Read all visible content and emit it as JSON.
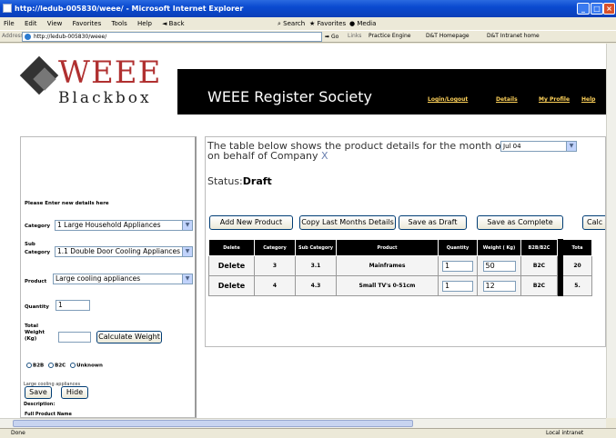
{
  "window": {
    "title": "http://ledub-005830/weee/ - Microsoft Internet Explorer"
  },
  "menu": {
    "items": [
      "File",
      "Edit",
      "View",
      "Favorites",
      "Tools",
      "Help"
    ],
    "back": "Back",
    "search": "Search",
    "favorites": "Favorites",
    "media": "Media"
  },
  "address": {
    "label": "Address",
    "url": "http://ledub-005830/weee/",
    "go": "Go",
    "links_label": "Links",
    "links": [
      "Practice Engine",
      "D&T Homepage",
      "D&T Intranet home"
    ]
  },
  "header": {
    "logo_top": "WEEE",
    "logo_bottom": "Blackbox",
    "society": "WEEE Register Society",
    "nav": [
      "Login/Logout",
      "Details",
      "My Profile",
      "Help"
    ]
  },
  "form": {
    "intro": "Please Enter new details here",
    "category_label": "Category",
    "category_value": "1 Large Household Appliances",
    "sub_label_1": "Sub",
    "sub_label_2": "Category",
    "subcategory_value": "1.1 Double Door Cooling Appliances",
    "product_label": "Product",
    "product_value": "Large cooling appliances",
    "quantity_label": "Quantity",
    "quantity_value": "1",
    "weight_label_1": "Total",
    "weight_label_2": "Weight",
    "weight_label_3": "(Kg)",
    "weight_value": "",
    "calc_button": "Calculate Weight",
    "radio_b2b": "B2B",
    "radio_b2c": "B2C",
    "radio_unknown": "Unknown",
    "save_button": "Save",
    "hide_button": "Hide",
    "full_name_label": "Full Product Name",
    "full_name_value": "Large cooling appliances",
    "description_label": "Description:"
  },
  "main": {
    "intro_line1": "The table below shows the product details for the month of",
    "month": "Jul 04",
    "intro_line2": "on behalf of Company",
    "company": "X",
    "status_label": "Status:",
    "status_value": "Draft",
    "buttons": [
      "Add New Product",
      "Copy Last Months Details",
      "Save as Draft",
      "Save as Complete",
      "Calc W"
    ]
  },
  "table": {
    "headers": [
      "Delete",
      "Category",
      "Sub Category",
      "Product",
      "Quantity",
      "Weight ( Kg)",
      "B2B/B2C",
      "Tota"
    ],
    "rows": [
      {
        "delete": "Delete",
        "category": "3",
        "sub": "3.1",
        "product": "Mainframes",
        "quantity": "1",
        "weight": "50",
        "type": "B2C",
        "total": "20"
      },
      {
        "delete": "Delete",
        "category": "4",
        "sub": "4.3",
        "product": "Small TV's 0-51cm",
        "quantity": "1",
        "weight": "12",
        "type": "B2C",
        "total": "5."
      }
    ]
  },
  "statusbar": {
    "left": "Done",
    "right": "Local intranet"
  }
}
